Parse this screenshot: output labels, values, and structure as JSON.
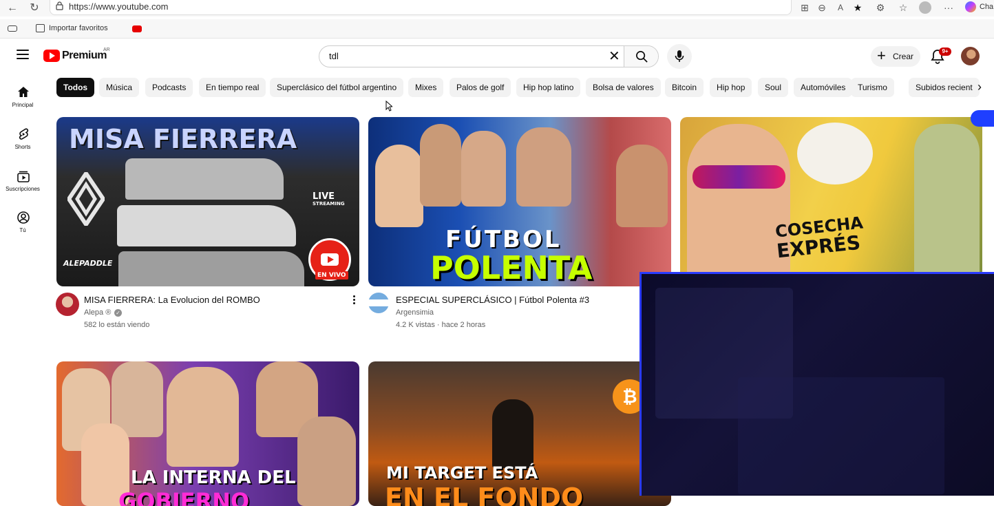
{
  "browser": {
    "url": "https://www.youtube.com",
    "bookmarks": {
      "import_label": "Importar favoritos"
    },
    "right_cutoff_label": "Cha"
  },
  "header": {
    "logo_text": "Premium",
    "logo_region": "AR",
    "search_value": "tdl",
    "create_label": "Crear",
    "notification_count": "9+"
  },
  "sidebar": {
    "items": [
      {
        "label": "Principal",
        "icon": "home-icon"
      },
      {
        "label": "Shorts",
        "icon": "shorts-icon"
      },
      {
        "label": "Suscripciones",
        "icon": "subscriptions-icon"
      },
      {
        "label": "Tú",
        "icon": "you-icon"
      }
    ]
  },
  "chips": [
    "Todos",
    "Música",
    "Podcasts",
    "En tiempo real",
    "Superclásico del fútbol argentino",
    "Mixes",
    "Palos de golf",
    "Hip hop latino",
    "Bolsa de valores",
    "Bitcoin",
    "Hip hop",
    "Soul",
    "Automóviles",
    "Turismo",
    "Subidos recient"
  ],
  "videos": [
    {
      "thumb_text": "MISA FIERRERA",
      "thumb_badge": "LIVE",
      "thumb_badge_sub": "STREAMING",
      "thumb_channel_mark": "ALEPADDLE",
      "live_badge": "EN VIVO",
      "title": "MISA FIERRERA: La Evolucion del ROMBO",
      "channel": "Alepa ®",
      "stats": "582 lo están viendo"
    },
    {
      "thumb_text_top": "FÚTBOL",
      "thumb_text_bottom": "POLENTA",
      "title": "ESPECIAL SUPERCLÁSICO | Fútbol Polenta #3",
      "channel": "Argensimia",
      "stats": "4.2 K vistas · hace 2 horas"
    },
    {
      "thumb_text_top": "COSECHA",
      "thumb_text_bottom": "EXPRÉS"
    },
    {
      "thumb_text_top": "LA INTERNA DEL",
      "thumb_text_bottom": "GOBIERNO"
    },
    {
      "thumb_text_top": "MI TARGET ESTÁ",
      "thumb_text_bottom": "EN EL FONDO"
    }
  ]
}
